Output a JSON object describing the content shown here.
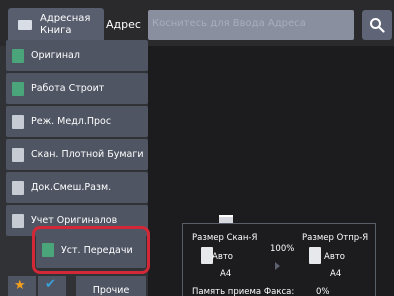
{
  "header": {
    "address_book_label": "Адресная Книга",
    "address_label": "Адрес",
    "address_placeholder": "Коснитесь для Ввода Адреса"
  },
  "menu": {
    "items": [
      {
        "label": "Оригинал",
        "icon": "original-icon"
      },
      {
        "label": "Работа Строит",
        "icon": "build-job-icon"
      },
      {
        "label": "Реж. Медл.Прос",
        "icon": "slow-scan-icon"
      },
      {
        "label": "Скан. Плотной Бумаги",
        "icon": "thick-paper-icon"
      },
      {
        "label": "Док.Смеш.Разм.",
        "icon": "mixed-size-icon"
      },
      {
        "label": "Учет Оригиналов",
        "icon": "original-count-icon"
      },
      {
        "label": "Уст. Передачи",
        "icon": "transmission-settings-icon"
      }
    ],
    "other_label": "Прочие"
  },
  "preview": {
    "scan_size_label": "Размер Скан-Я",
    "send_size_label": "Размер Отпр-Я",
    "zoom": "100%",
    "scan_auto": "Авто",
    "send_auto": "Авто",
    "scan_paper": "A4",
    "send_paper": "A4",
    "memory_label": "Память приема Факса:",
    "memory_value": "0%"
  },
  "colors": {
    "highlight": "#d22837",
    "favorite_star": "#f4a01c",
    "check": "#3aa0d9"
  }
}
